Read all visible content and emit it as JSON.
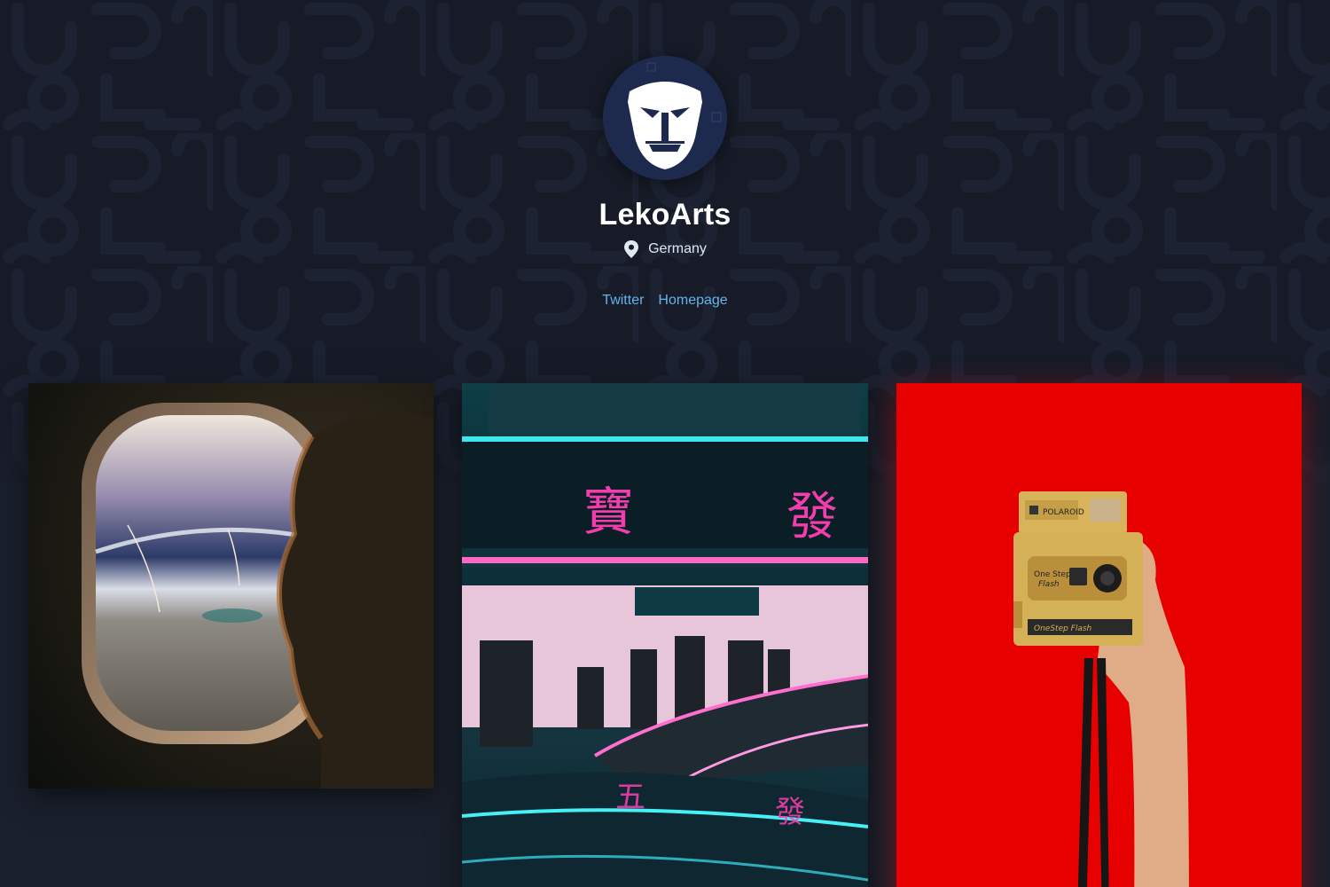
{
  "profile": {
    "name": "LekoArts",
    "location": "Germany",
    "location_icon": "map-pin-icon",
    "avatar_icon": "lion-icon"
  },
  "links": [
    {
      "label": "Twitter"
    },
    {
      "label": "Homepage"
    }
  ],
  "gallery": [
    {
      "subject": "airplane-window-earth",
      "type": "photo"
    },
    {
      "subject": "neon-street-night",
      "type": "photo"
    },
    {
      "subject": "polaroid-camera-red",
      "type": "photo"
    }
  ],
  "colors": {
    "background": "#1a202c",
    "hero": "#161b27",
    "link": "#63b3ed",
    "avatar": "#1e2a4d",
    "accent_red": "#e60000"
  }
}
